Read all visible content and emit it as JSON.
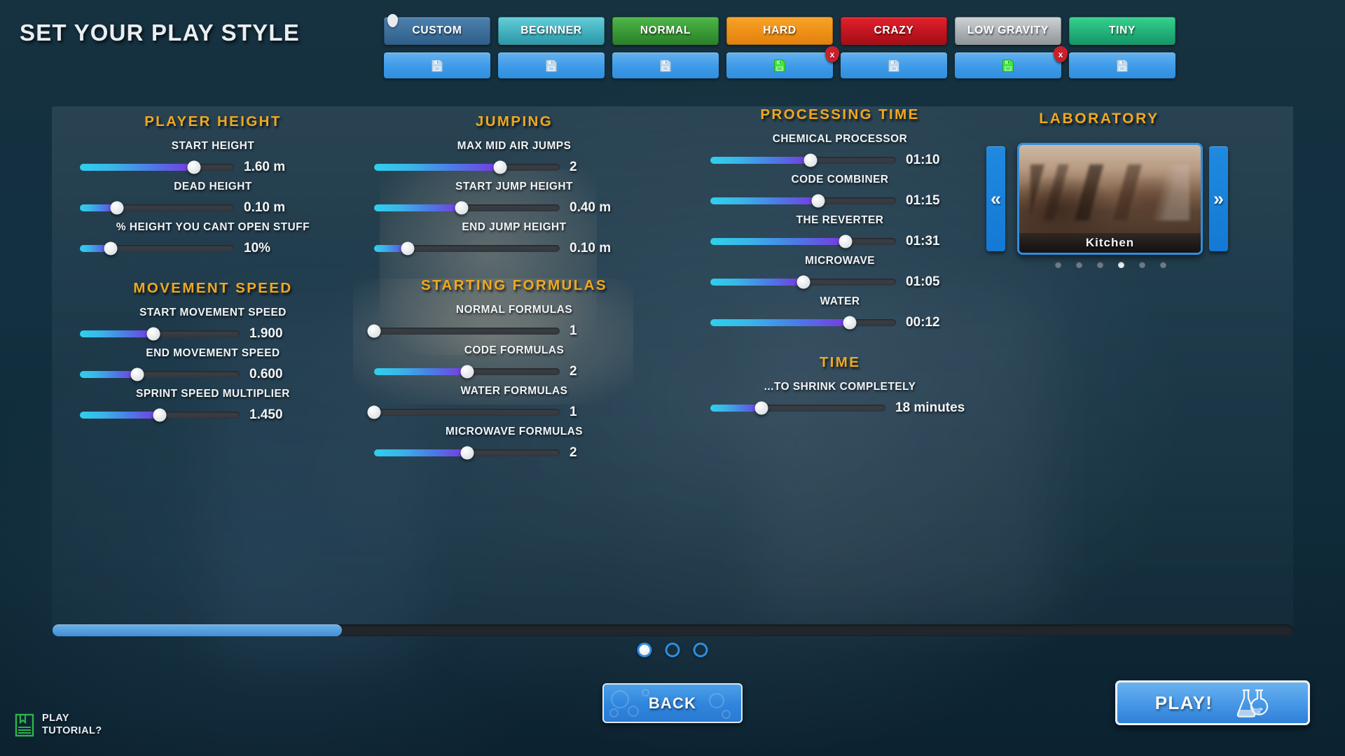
{
  "header": {
    "title": "SET YOUR PLAY STYLE"
  },
  "presets": [
    {
      "label": "CUSTOM",
      "color": "#3a6f9e",
      "selected": true,
      "save_icon": "floppy-disk-icon",
      "save_state": "empty",
      "deletable": false
    },
    {
      "label": "BEGINNER",
      "color": "#44b6c4",
      "selected": false,
      "save_icon": "floppy-disk-icon",
      "save_state": "empty",
      "deletable": false
    },
    {
      "label": "NORMAL",
      "color": "#3a9e38",
      "selected": false,
      "save_icon": "floppy-disk-icon",
      "save_state": "empty",
      "deletable": false
    },
    {
      "label": "HARD",
      "color": "#ef8e15",
      "selected": false,
      "save_icon": "floppy-disk-icon",
      "save_state": "filled",
      "deletable": true
    },
    {
      "label": "CRAZY",
      "color": "#cf1420",
      "selected": false,
      "save_icon": "floppy-disk-icon",
      "save_state": "empty",
      "deletable": false
    },
    {
      "label": "LOW GRAVITY",
      "color": "#a9adb0",
      "selected": false,
      "save_icon": "floppy-disk-icon",
      "save_state": "filled",
      "deletable": true
    },
    {
      "label": "TINY",
      "color": "#23b877",
      "selected": false,
      "save_icon": "floppy-disk-icon",
      "save_state": "empty",
      "deletable": false
    }
  ],
  "delete_badge_label": "x",
  "sections": {
    "player_height": {
      "title": "PLAYER HEIGHT",
      "sliders": [
        {
          "label": "START HEIGHT",
          "value": "1.60 m",
          "pct": 74
        },
        {
          "label": "DEAD HEIGHT",
          "value": "0.10 m",
          "pct": 24
        },
        {
          "label": "% HEIGHT YOU CANT OPEN STUFF",
          "value": "10%",
          "pct": 20
        }
      ]
    },
    "movement_speed": {
      "title": "MOVEMENT SPEED",
      "sliders": [
        {
          "label": "START MOVEMENT SPEED",
          "value": "1.900",
          "pct": 46
        },
        {
          "label": "END MOVEMENT SPEED",
          "value": "0.600",
          "pct": 36
        },
        {
          "label": "SPRINT SPEED MULTIPLIER",
          "value": "1.450",
          "pct": 50
        }
      ]
    },
    "jumping": {
      "title": "JUMPING",
      "sliders": [
        {
          "label": "MAX MID AIR JUMPS",
          "value": "2",
          "pct": 68
        },
        {
          "label": "START JUMP HEIGHT",
          "value": "0.40 m",
          "pct": 47
        },
        {
          "label": "END JUMP HEIGHT",
          "value": "0.10 m",
          "pct": 18
        }
      ]
    },
    "starting_formulas": {
      "title": "STARTING FORMULAS",
      "sliders": [
        {
          "label": "NORMAL FORMULAS",
          "value": "1",
          "pct": 0
        },
        {
          "label": "CODE FORMULAS",
          "value": "2",
          "pct": 50
        },
        {
          "label": "WATER FORMULAS",
          "value": "1",
          "pct": 0
        },
        {
          "label": "MICROWAVE FORMULAS",
          "value": "2",
          "pct": 50
        }
      ]
    },
    "processing_time": {
      "title": "PROCESSING TIME",
      "sliders": [
        {
          "label": "CHEMICAL PROCESSOR",
          "value": "01:10",
          "pct": 54
        },
        {
          "label": "CODE COMBINER",
          "value": "01:15",
          "pct": 58
        },
        {
          "label": "THE REVERTER",
          "value": "01:31",
          "pct": 73
        },
        {
          "label": "MICROWAVE",
          "value": "01:05",
          "pct": 50
        },
        {
          "label": "WATER",
          "value": "00:12",
          "pct": 75
        }
      ]
    },
    "time": {
      "title": "TIME",
      "sliders": [
        {
          "label": "...TO SHRINK COMPLETELY",
          "value": "18 minutes",
          "pct": 29
        }
      ]
    }
  },
  "laboratory": {
    "title": "LABORATORY",
    "prev_icon": "chevron-left-double-icon",
    "next_icon": "chevron-right-double-icon",
    "prev_label": "«",
    "next_label": "»",
    "selected_name": "Kitchen",
    "dot_count": 6,
    "active_dot": 4
  },
  "footer": {
    "progress_pct": 23.3,
    "page_dots": 3,
    "active_page": 1,
    "back_label": "BACK",
    "play_label": "PLAY!",
    "play_icon": "flasks-icon",
    "tutorial_line1": "PLAY",
    "tutorial_line2": "TUTORIAL?",
    "tutorial_icon": "book-icon"
  },
  "colors": {
    "accent_orange": "#f0a81f",
    "accent_blue": "#2f8ede",
    "slider_start": "#2fd0ec",
    "slider_end": "#7b35e0",
    "danger": "#c9202a"
  }
}
